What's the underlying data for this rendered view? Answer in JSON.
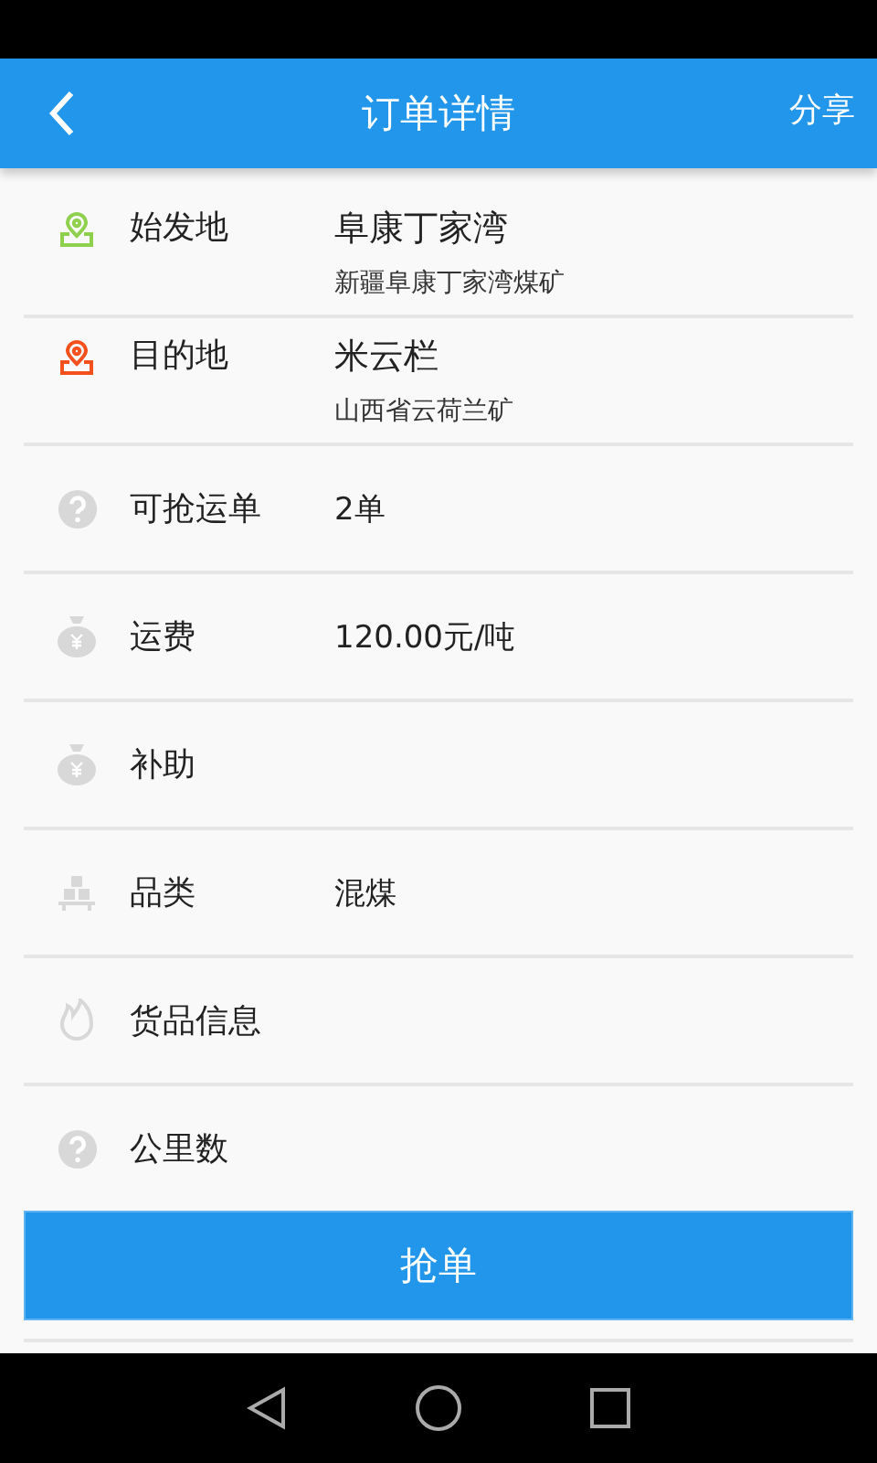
{
  "header": {
    "title": "订单详情",
    "action": "分享"
  },
  "locations": [
    {
      "label": "始发地",
      "place": "阜康丁家湾",
      "address": "新疆阜康丁家湾煤矿",
      "color": "#8fd14f"
    },
    {
      "label": "目的地",
      "place": "米云栏",
      "address": "山西省云荷兰矿",
      "color": "#f4511e"
    }
  ],
  "details": [
    {
      "kind": "question",
      "label": "可抢运单",
      "value": "2单"
    },
    {
      "kind": "moneybag",
      "label": "运费",
      "value": "120.00元/吨"
    },
    {
      "kind": "moneybag",
      "label": "补助"
    },
    {
      "kind": "boxes",
      "label": "品类",
      "value": "混煤"
    },
    {
      "kind": "flame",
      "label": "货品信息"
    },
    {
      "kind": "question",
      "label": "公里数"
    }
  ],
  "button": "抢单"
}
